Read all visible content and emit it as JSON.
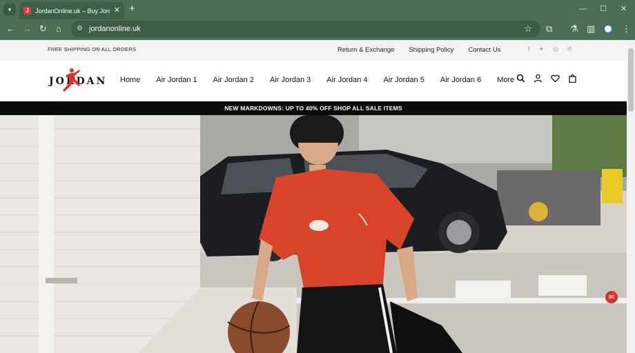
{
  "browser": {
    "tab_title": "JordanOnline.uk – Buy Jordan",
    "url": "jordanonline.uk",
    "icons": {
      "tab_search": "chevron-down-icon",
      "tab_close": "close-icon",
      "new_tab": "plus-icon",
      "back": "back-arrow-icon",
      "forward": "forward-arrow-icon",
      "reload": "reload-icon",
      "home": "home-icon",
      "bookmark": "star-icon",
      "extensions": "puzzle-icon",
      "labs": "flask-icon",
      "sidepanel": "sidepanel-icon",
      "profile": "profile-icon",
      "menu": "kebab-menu-icon"
    }
  },
  "topbar": {
    "shipping_text": "FREE SHIPPING ON ALL ORDERS",
    "links": [
      "Return & Exchange",
      "Shipping Policy",
      "Contact Us"
    ],
    "socials": [
      "facebook-icon",
      "twitter-icon",
      "instagram-icon",
      "pinterest-icon"
    ]
  },
  "header": {
    "logo_text": "JORDAN",
    "nav": [
      "Home",
      "Air Jordan 1",
      "Air Jordan 2",
      "Air Jordan 3",
      "Air Jordan 4",
      "Air Jordan 5",
      "Air Jordan 6",
      "More"
    ],
    "icons": [
      "search-icon",
      "account-icon",
      "wishlist-heart-icon",
      "cart-bag-icon"
    ]
  },
  "promo": {
    "text": "NEW MARKDOWNS: UP TO 40% OFF SHOP ALL SALE ITEMS"
  },
  "colors": {
    "chrome": "#4d6e55",
    "brand_red": "#d9322b",
    "promo_bg": "#0c0c0c"
  }
}
